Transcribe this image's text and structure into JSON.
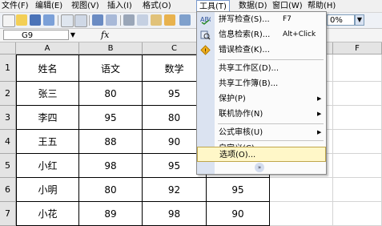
{
  "menubar": {
    "items": [
      "文件(F)",
      "编辑(E)",
      "视图(V)",
      "插入(I)",
      "格式(O)",
      "工具(T)",
      "数据(D)",
      "窗口(W)",
      "帮助(H)"
    ]
  },
  "toolbar": {
    "zoom": "0%"
  },
  "formula_bar": {
    "cell_ref": "G9",
    "fx": "fx"
  },
  "columns": [
    "A",
    "B",
    "C",
    "D",
    "E",
    "F"
  ],
  "rows": [
    "1",
    "2",
    "3",
    "4",
    "5",
    "6",
    "7"
  ],
  "table": {
    "header": [
      "姓名",
      "语文",
      "数学"
    ],
    "rows": [
      [
        "张三",
        "80",
        "95"
      ],
      [
        "李四",
        "95",
        "80"
      ],
      [
        "王五",
        "88",
        "90"
      ],
      [
        "小红",
        "98",
        "95"
      ],
      [
        "小明",
        "80",
        "92"
      ],
      [
        "小花",
        "89",
        "98"
      ]
    ],
    "col_d_visible": [
      "95",
      "90"
    ]
  },
  "tools_menu": {
    "items": [
      {
        "label": "拼写检查(S)...",
        "shortcut": "F7",
        "icon": "spellcheck-icon"
      },
      {
        "label": "信息检索(R)...",
        "shortcut": "Alt+Click",
        "icon": "research-icon"
      },
      {
        "label": "错误检查(K)...",
        "shortcut": "",
        "icon": "error-check-icon"
      },
      {
        "label": "共享工作区(D)...",
        "shortcut": ""
      },
      {
        "label": "共享工作簿(B)...",
        "shortcut": ""
      },
      {
        "label": "保护(P)",
        "submenu": true
      },
      {
        "label": "联机协作(N)",
        "submenu": true
      },
      {
        "label": "公式审核(U)",
        "submenu": true
      },
      {
        "label": "自定义(C)...",
        "shortcut": ""
      },
      {
        "label": "选项(O)...",
        "shortcut": "",
        "highlighted": true
      }
    ],
    "expand_icon": "double-chevron-down-icon"
  },
  "colors": {
    "menu_highlight": "#fff7c8",
    "menu_gutter": "#dbe3f1",
    "header_bg": "#e4e4e4"
  }
}
